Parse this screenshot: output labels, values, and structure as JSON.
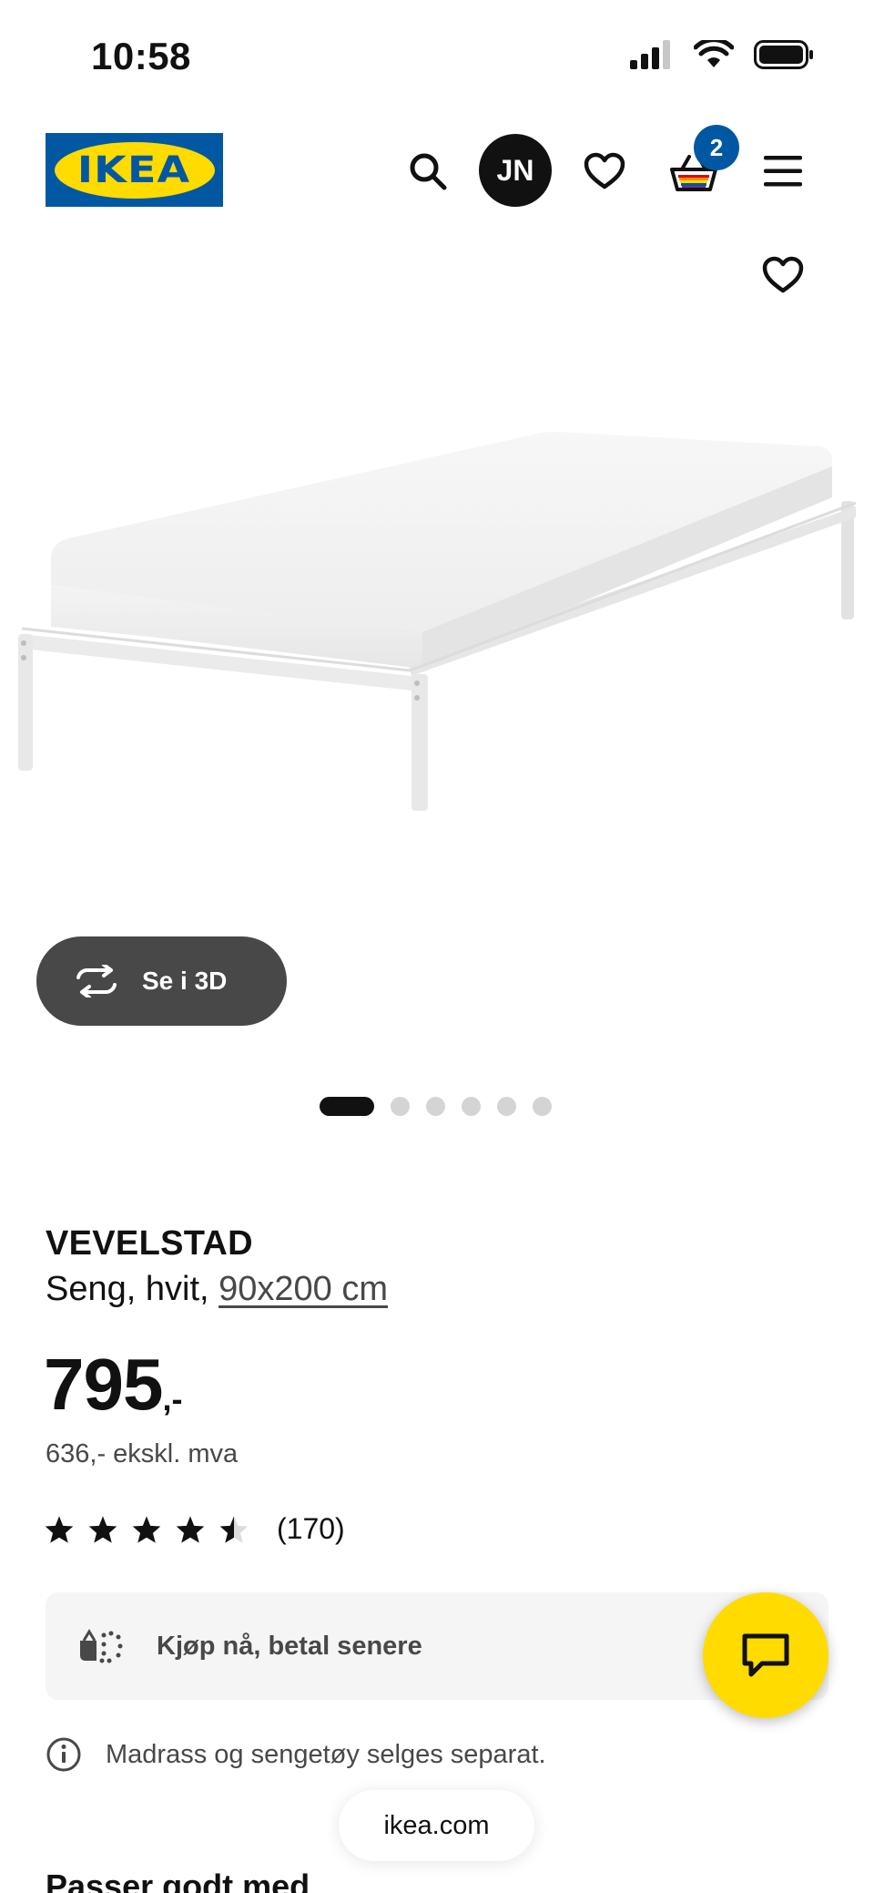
{
  "status_bar": {
    "time": "10:58",
    "icons": [
      "cellular-signal-icon",
      "wifi-icon",
      "battery-icon"
    ]
  },
  "header": {
    "logo_text": "IKEA",
    "logo_colors": {
      "background": "#0058a3",
      "oval": "#ffdb00"
    },
    "avatar_initials": "JN",
    "cart_count": "2",
    "icons": [
      "search-icon",
      "heart-icon",
      "cart-icon",
      "menu-icon"
    ]
  },
  "gallery": {
    "favorite_icon": "heart-icon",
    "view_3d_label": "Se i 3D",
    "view_3d_icon": "rotate-3d-icon",
    "image_count": 6,
    "active_index": 0
  },
  "product": {
    "name": "VEVELSTAD",
    "description": "Seng, hvit, ",
    "size": "90x200 cm",
    "price": "795",
    "price_suffix": ",-",
    "price_excl_vat": "636,- ekskl. mva",
    "rating": 4.5,
    "rating_max": 5,
    "review_count": "(170)"
  },
  "pay_later": {
    "label": "Kjøp nå, betal senere",
    "icon": "pay-later-icon"
  },
  "info_note": {
    "text": "Madrass og sengetøy selges separat.",
    "icon": "info-icon"
  },
  "chat": {
    "icon": "chat-icon",
    "color": "#ffdb00"
  },
  "browser": {
    "url": "ikea.com"
  },
  "next_section": {
    "heading": "Passer godt med"
  }
}
